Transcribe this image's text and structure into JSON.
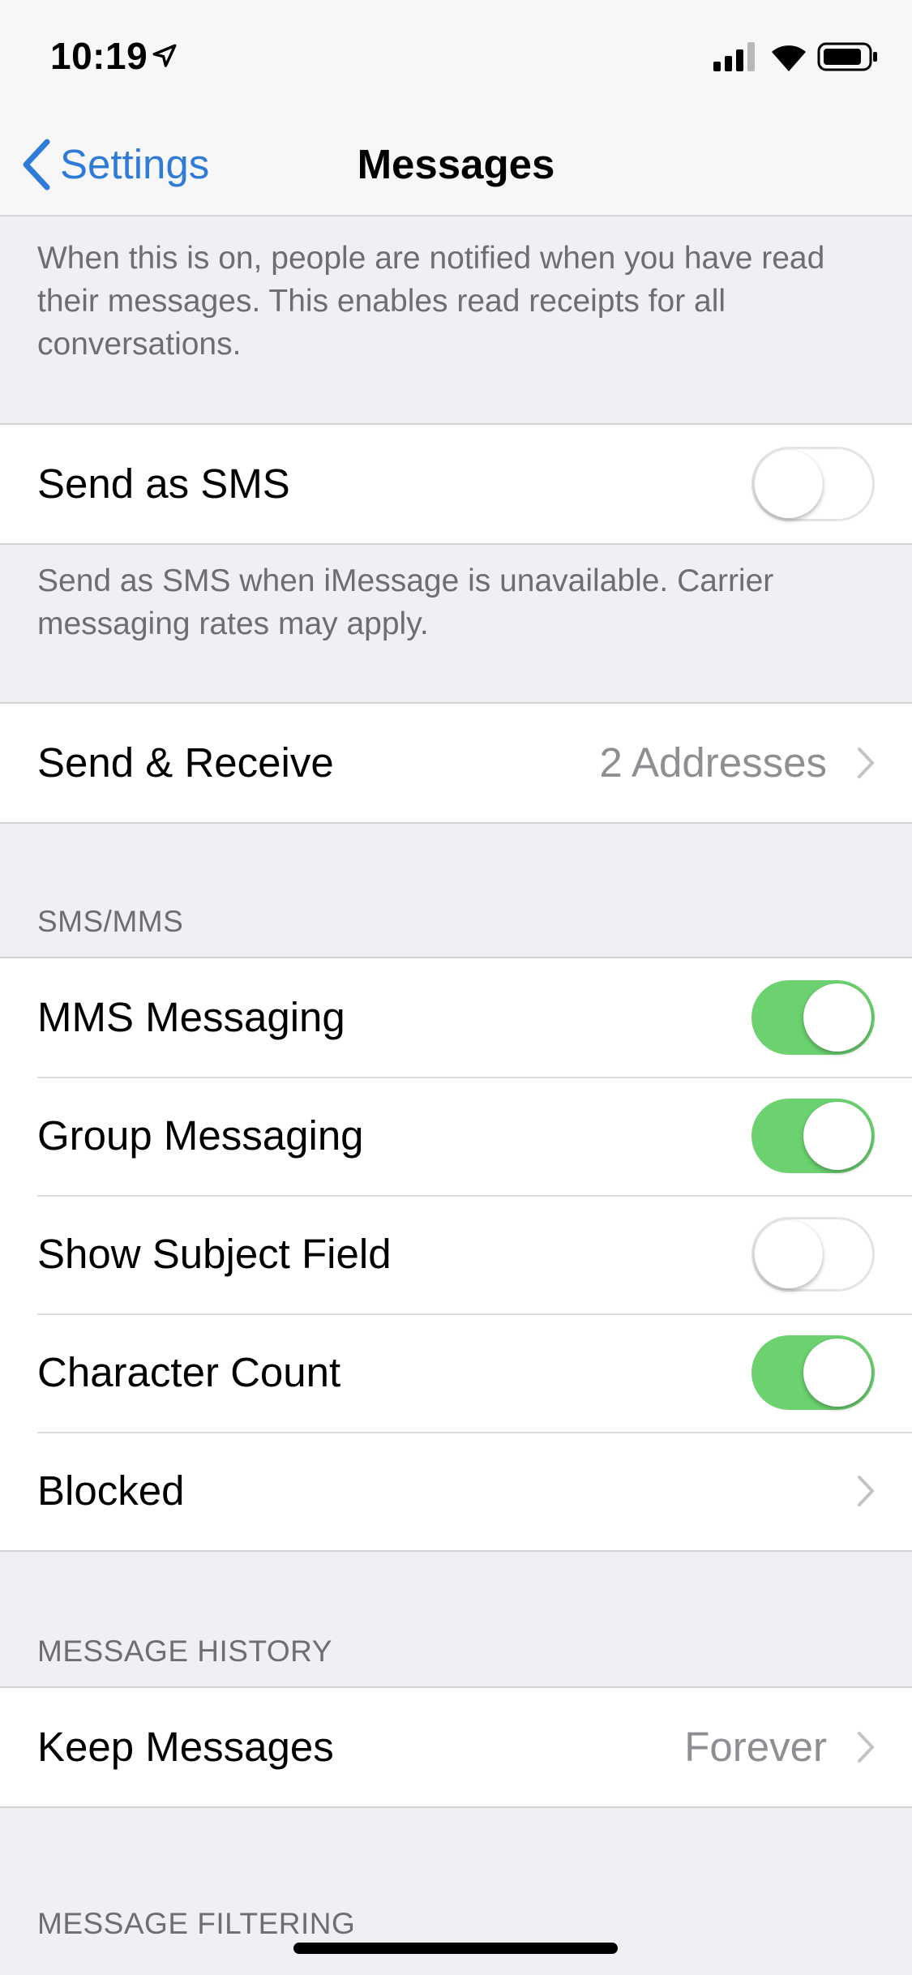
{
  "status_bar": {
    "time": "10:19",
    "icons": [
      "location-arrow-icon",
      "cellular-signal-icon",
      "wifi-icon",
      "battery-icon"
    ]
  },
  "nav": {
    "back_label": "Settings",
    "title": "Messages",
    "accent_color": "#2f7bd8"
  },
  "read_receipts_footer": "When this is on, people are notified when you have read their messages. This enables read receipts for all conversations.",
  "send_as_sms": {
    "label": "Send as SMS",
    "on": false,
    "footer": "Send as SMS when iMessage is unavailable. Carrier messaging rates may apply."
  },
  "send_receive": {
    "label": "Send & Receive",
    "value": "2 Addresses"
  },
  "sms_mms": {
    "header": "SMS/MMS",
    "mms_messaging": {
      "label": "MMS Messaging",
      "on": true
    },
    "group_messaging": {
      "label": "Group Messaging",
      "on": true
    },
    "show_subject_field": {
      "label": "Show Subject Field",
      "on": false
    },
    "character_count": {
      "label": "Character Count",
      "on": true
    },
    "blocked": {
      "label": "Blocked"
    }
  },
  "message_history": {
    "header": "MESSAGE HISTORY",
    "keep_messages": {
      "label": "Keep Messages",
      "value": "Forever"
    }
  },
  "message_filtering": {
    "header": "MESSAGE FILTERING"
  },
  "colors": {
    "toggle_on": "#6bd26f",
    "background": "#efeff4"
  }
}
